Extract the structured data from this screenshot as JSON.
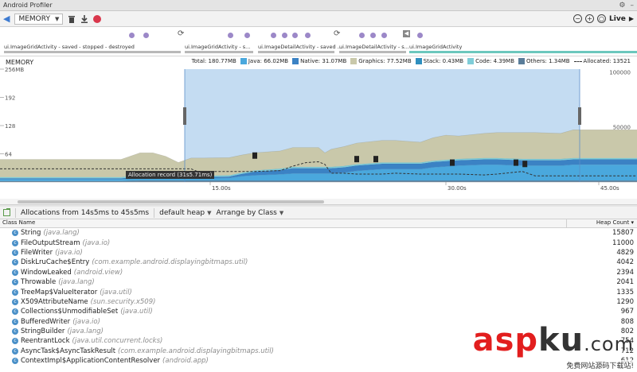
{
  "window": {
    "title": "Android Profiler"
  },
  "toolbar": {
    "process": "MEMORY",
    "live_label": "Live"
  },
  "colors": {
    "java": "#4aa8dd",
    "native": "#3b82c4",
    "graphics": "#c9c8aa",
    "stack": "#2f8fbf",
    "code": "#7fcdd8",
    "others": "#5a7d9a",
    "selection": "#c4dcf2",
    "record": "#d9374c",
    "event_dot": "#9c88c8"
  },
  "activities": [
    {
      "label": "ui.ImageGridActivity - saved - stopped - destroyed"
    },
    {
      "label": "ui.ImageGridActivity - s..."
    },
    {
      "label": "ui.ImageDetailActivity - saved ..."
    },
    {
      "label": "ui.ImageDetailActivity - s..."
    },
    {
      "label": "ui.ImageGridActivity"
    }
  ],
  "memory": {
    "title": "MEMORY",
    "legend": {
      "total": "Total: 180.77MB",
      "java": "Java: 66.02MB",
      "native": "Native: 31.07MB",
      "graphics": "Graphics: 77.52MB",
      "stack": "Stack: 0.43MB",
      "code": "Code: 4.39MB",
      "others": "Others: 1.34MB",
      "allocated": "Allocated: 13521"
    },
    "tooltip": "Allocation record (31s5.71ms)"
  },
  "chart_data": {
    "type": "area",
    "title": "MEMORY",
    "y_left_ticks": [
      "256MB",
      "192",
      "128",
      "64"
    ],
    "y_right_ticks": [
      "100000",
      "50000"
    ],
    "x_ticks": [
      "15.00s",
      "30.00s",
      "45.00s"
    ],
    "x": [
      0,
      4,
      6,
      9.5,
      11,
      12,
      13,
      14,
      15,
      15.5,
      16,
      18,
      19,
      20,
      22,
      23,
      24,
      25,
      25.5,
      26,
      27,
      28,
      30,
      31,
      33,
      34,
      35,
      36,
      38,
      39,
      41,
      42,
      44,
      45,
      46,
      48,
      50
    ],
    "series": [
      {
        "name": "Others",
        "values": [
          2,
          2,
          2,
          2,
          3,
          3,
          3,
          3,
          3,
          3,
          3,
          3,
          3,
          3,
          3,
          3,
          3,
          3,
          3,
          3,
          3,
          3,
          3,
          3,
          3,
          3,
          3,
          3,
          3,
          3,
          3,
          3,
          3,
          3,
          3,
          3,
          3
        ]
      },
      {
        "name": "Stack",
        "values": [
          0.4,
          0.4,
          0.4,
          0.4,
          0.4,
          0.4,
          0.4,
          0.4,
          0.4,
          0.4,
          0.4,
          0.4,
          0.4,
          0.4,
          0.4,
          0.4,
          0.4,
          0.4,
          0.4,
          0.4,
          0.4,
          0.4,
          0.4,
          0.4,
          0.4,
          0.4,
          0.4,
          0.4,
          0.4,
          0.4,
          0.4,
          0.4,
          0.4,
          0.4,
          0.4,
          0.4,
          0.4
        ]
      },
      {
        "name": "Java",
        "values": [
          4,
          4,
          4,
          4,
          5,
          5,
          5,
          5,
          5,
          5,
          5,
          6,
          10,
          12,
          14,
          16,
          16,
          16,
          16,
          16,
          18,
          22,
          26,
          26,
          26,
          30,
          32,
          34,
          36,
          36,
          34,
          34,
          34,
          36,
          36,
          36,
          36
        ]
      },
      {
        "name": "Native",
        "values": [
          2,
          2,
          2,
          2,
          3,
          3,
          3,
          3,
          3,
          3,
          3,
          3,
          5,
          8,
          10,
          12,
          12,
          12,
          12,
          12,
          12,
          12,
          12,
          12,
          12,
          12,
          12,
          12,
          12,
          12,
          12,
          12,
          12,
          12,
          12,
          12,
          12
        ]
      },
      {
        "name": "Code",
        "values": [
          3,
          3,
          3,
          3,
          3,
          3,
          3,
          3,
          3,
          3,
          3,
          3,
          3,
          3,
          3,
          3,
          3,
          3,
          3,
          3,
          3,
          3,
          3,
          3,
          3,
          3,
          3,
          3,
          3,
          3,
          3,
          3,
          3,
          3,
          3,
          3,
          3
        ]
      },
      {
        "name": "Graphics",
        "values": [
          40,
          40,
          40,
          40,
          52,
          52,
          44,
          30,
          40,
          40,
          40,
          40,
          40,
          40,
          40,
          44,
          44,
          44,
          32,
          40,
          44,
          48,
          50,
          50,
          46,
          52,
          56,
          52,
          56,
          58,
          60,
          60,
          58,
          64,
          64,
          64,
          64
        ]
      }
    ],
    "allocated": [
      30,
      30,
      30,
      30,
      30,
      30,
      30,
      30,
      30,
      24,
      24,
      24,
      24,
      24,
      26,
      36,
      44,
      46,
      40,
      20,
      20,
      18,
      18,
      20,
      18,
      18,
      18,
      18,
      16,
      18,
      24,
      14,
      14,
      14,
      14,
      14,
      14
    ],
    "selection": [
      14.5,
      45.5
    ],
    "ylim": [
      0,
      256
    ],
    "xlim": [
      0,
      50
    ]
  },
  "allocations": {
    "range_label": "Allocations from 14s5ms to 45s5ms",
    "heap": "default heap",
    "arrange": "Arrange by Class",
    "col_class": "Class Name",
    "col_count": "Heap Count",
    "rows": [
      {
        "name": "String",
        "pkg": "(java.lang)",
        "count": "15807"
      },
      {
        "name": "FileOutputStream",
        "pkg": "(java.io)",
        "count": "11000"
      },
      {
        "name": "FileWriter",
        "pkg": "(java.io)",
        "count": "4829"
      },
      {
        "name": "DiskLruCache$Entry",
        "pkg": "(com.example.android.displayingbitmaps.util)",
        "count": "4042"
      },
      {
        "name": "WindowLeaked",
        "pkg": "(android.view)",
        "count": "2394"
      },
      {
        "name": "Throwable",
        "pkg": "(java.lang)",
        "count": "2041"
      },
      {
        "name": "TreeMap$ValueIterator",
        "pkg": "(java.util)",
        "count": "1335"
      },
      {
        "name": "X509AttributeName",
        "pkg": "(sun.security.x509)",
        "count": "1290"
      },
      {
        "name": "Collections$UnmodifiableSet",
        "pkg": "(java.util)",
        "count": "967"
      },
      {
        "name": "BufferedWriter",
        "pkg": "(java.io)",
        "count": "808"
      },
      {
        "name": "StringBuilder",
        "pkg": "(java.lang)",
        "count": "802"
      },
      {
        "name": "ReentrantLock",
        "pkg": "(java.util.concurrent.locks)",
        "count": "754"
      },
      {
        "name": "AsyncTask$AsyncTaskResult",
        "pkg": "(com.example.android.displayingbitmaps.util)",
        "count": "712"
      },
      {
        "name": "ContextImpl$ApplicationContentResolver",
        "pkg": "(android.app)",
        "count": "612"
      }
    ]
  },
  "watermark": {
    "brand_a": "asp",
    "brand_b": "ku",
    "brand_c": ".com",
    "sub": "免费网站源码下载站!"
  }
}
